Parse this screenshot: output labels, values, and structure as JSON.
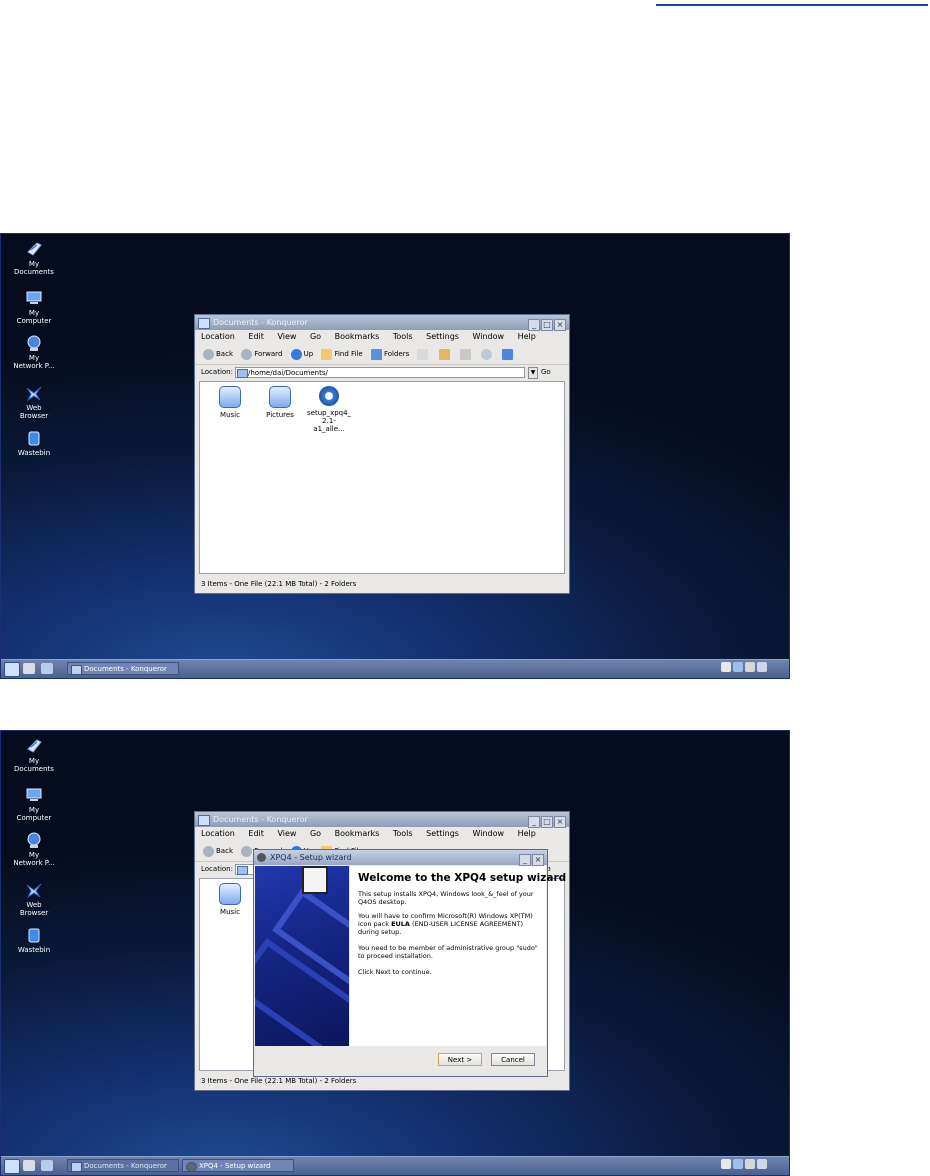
{
  "desktop": {
    "icons": [
      {
        "label_line1": "My",
        "label_line2": "Documents"
      },
      {
        "label_line1": "My",
        "label_line2": "Computer"
      },
      {
        "label_line1": "My",
        "label_line2": "Network P..."
      },
      {
        "label_line1": "Web",
        "label_line2": "Browser"
      },
      {
        "label_line1": "Wastebin",
        "label_line2": ""
      }
    ]
  },
  "konqueror": {
    "title": "Documents - Konqueror",
    "menu": [
      "Location",
      "Edit",
      "View",
      "Go",
      "Bookmarks",
      "Tools",
      "Settings",
      "Window",
      "Help"
    ],
    "toolbar": {
      "back": "Back",
      "forward": "Forward",
      "up": "Up",
      "find_file": "Find File",
      "folders": "Folders"
    },
    "location_label": "Location:",
    "location_value": "/home/dai/Documents/",
    "go_label": "Go",
    "files": [
      {
        "line1": "Music",
        "line2": "",
        "line3": ""
      },
      {
        "line1": "Pictures",
        "line2": "",
        "line3": ""
      },
      {
        "line1": "setup_xpq4_",
        "line2": "2.1-a1_alle...",
        "line3": ""
      }
    ],
    "status": "3 Items - One File (22.1 MB Total) - 2 Folders"
  },
  "wizard": {
    "title": "XPQ4 - Setup wizard",
    "heading": "Welcome to the XPQ4 setup wizard",
    "para1": "This setup installs XPQ4, Windows look_&_feel of your Q4OS desktop.",
    "para2a": "You will have to confirm Microsoft(R) Windows XP(TM) icon pack ",
    "para2b": "EULA",
    "para2c": " (END-USER LICENSE AGREEMENT) during setup.",
    "para3": "You need to be member of administrative group \"sudo\" to proceed installation.",
    "para4": "Click Next to continue.",
    "next_label": "Next >",
    "cancel_label": "Cancel"
  },
  "taskbar": {
    "item_konqueror": "Documents - Konqueror",
    "item_wizard": "XPQ4 - Setup wizard"
  }
}
